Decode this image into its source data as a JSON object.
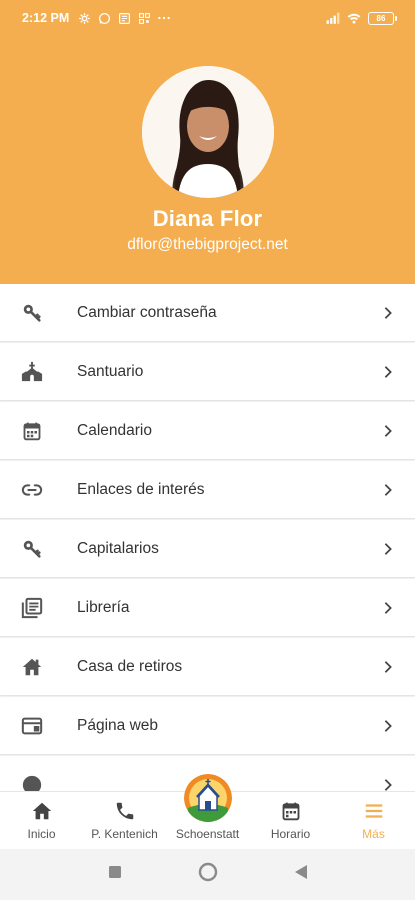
{
  "status_bar": {
    "time": "2:12 PM",
    "battery": "86"
  },
  "profile": {
    "name": "Diana Flor",
    "email": "dflor@thebigproject.net"
  },
  "menu": {
    "items": [
      {
        "label": "Cambiar contraseña",
        "icon": "key-icon"
      },
      {
        "label": "Santuario",
        "icon": "church-icon"
      },
      {
        "label": "Calendario",
        "icon": "calendar-icon"
      },
      {
        "label": "Enlaces de interés",
        "icon": "link-icon"
      },
      {
        "label": "Capitalarios",
        "icon": "key-icon"
      },
      {
        "label": "Librería",
        "icon": "library-icon"
      },
      {
        "label": "Casa de retiros",
        "icon": "house-icon"
      },
      {
        "label": "Página web",
        "icon": "web-icon"
      },
      {
        "label": "",
        "icon": "info-icon"
      }
    ]
  },
  "bottom_nav": {
    "items": [
      {
        "label": "Inicio",
        "icon": "home-icon"
      },
      {
        "label": "P. Kentenich",
        "icon": "phone-icon"
      },
      {
        "label": "Schoenstatt",
        "icon": "shrine-logo-icon"
      },
      {
        "label": "Horario",
        "icon": "calendar-icon"
      },
      {
        "label": "Más",
        "icon": "menu-icon",
        "active": true
      }
    ]
  },
  "colors": {
    "accent": "#f4ae4f",
    "text": "#333333",
    "icon": "#555555"
  }
}
